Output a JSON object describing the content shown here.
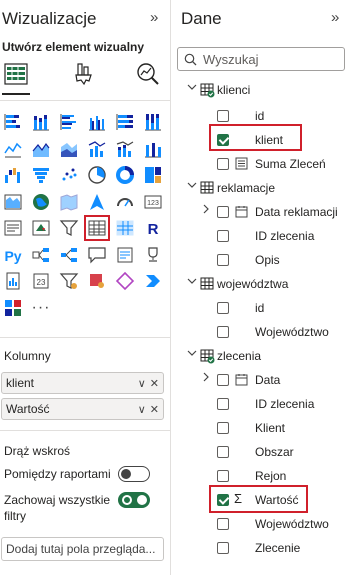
{
  "visualizations": {
    "title": "Wizualizacje",
    "collapse_icon": "chevron-double-right",
    "subtitle": "Utwórz element wizualny",
    "modes": [
      "build-visual-icon",
      "format-visual-icon",
      "analytics-icon"
    ],
    "gallery": [
      "stacked-bar-chart-icon",
      "stacked-column-chart-icon",
      "clustered-bar-chart-icon",
      "clustered-column-chart-icon",
      "100-stacked-bar-chart-icon",
      "100-stacked-column-chart-icon",
      "line-chart-icon",
      "area-chart-icon",
      "stacked-area-chart-icon",
      "line-and-column-chart-icon",
      "line-and-stacked-column-chart-icon",
      "ribbon-chart-icon",
      "waterfall-chart-icon",
      "funnel-chart-icon",
      "scatter-chart-icon",
      "pie-chart-icon",
      "donut-chart-icon",
      "treemap-icon",
      "map-icon",
      "filled-map-icon",
      "shape-map-icon",
      "azure-map-icon",
      "gauge-icon",
      "card-icon",
      "multi-row-card-icon",
      "kpi-icon",
      "slicer-icon",
      "table-icon",
      "matrix-icon",
      "r-visual-icon",
      "python-visual-icon",
      "key-influencers-icon",
      "decomposition-tree-icon",
      "qa-icon",
      "smart-narrative-icon",
      "trophy-icon",
      "paginated-report-icon",
      "power-apps-icon",
      "power-automate-icon",
      "diamond-visual-icon",
      "chevron-visual-icon",
      "arcgis-icon",
      "custom-visual-icon",
      "more-visuals-icon"
    ],
    "selected_gallery_item": "table-icon",
    "columns_label": "Kolumny",
    "wells": [
      {
        "text": "klient"
      },
      {
        "text": "Wartość"
      }
    ],
    "drill_label": "Drąż wskroś",
    "cross_report_label": "Pomiędzy raportami",
    "cross_report_state": "off",
    "keep_filters_label": "Zachowaj wszystkie filtry",
    "keep_filters_state": "on",
    "drill_placeholder": "Dodaj tutaj pola przegląda..."
  },
  "data_pane": {
    "title": "Dane",
    "search_placeholder": "Wyszukaj",
    "tables": [
      {
        "name": "klienci",
        "fields": [
          {
            "name": "id",
            "checked": false,
            "type": "plain",
            "expandable": false
          },
          {
            "name": "klient",
            "checked": true,
            "type": "plain",
            "expandable": false
          },
          {
            "name": "Suma Zleceń",
            "checked": false,
            "type": "measure",
            "expandable": false
          }
        ]
      },
      {
        "name": "reklamacje",
        "fields": [
          {
            "name": "Data reklamacji",
            "checked": false,
            "type": "date",
            "expandable": true
          },
          {
            "name": "ID zlecenia",
            "checked": false,
            "type": "plain",
            "expandable": false
          },
          {
            "name": "Opis",
            "checked": false,
            "type": "plain",
            "expandable": false
          }
        ]
      },
      {
        "name": "województwa",
        "fields": [
          {
            "name": "id",
            "checked": false,
            "type": "plain",
            "expandable": false
          },
          {
            "name": "Województwo",
            "checked": false,
            "type": "plain",
            "expandable": false
          }
        ]
      },
      {
        "name": "zlecenia",
        "fields": [
          {
            "name": "Data",
            "checked": false,
            "type": "date",
            "expandable": true
          },
          {
            "name": "ID zlecenia",
            "checked": false,
            "type": "plain",
            "expandable": false
          },
          {
            "name": "Klient",
            "checked": false,
            "type": "plain",
            "expandable": false
          },
          {
            "name": "Obszar",
            "checked": false,
            "type": "plain",
            "expandable": false
          },
          {
            "name": "Rejon",
            "checked": false,
            "type": "plain",
            "expandable": false
          },
          {
            "name": "Wartość",
            "checked": true,
            "type": "sum",
            "expandable": false
          },
          {
            "name": "Województwo",
            "checked": false,
            "type": "plain",
            "expandable": false
          },
          {
            "name": "Zlecenie",
            "checked": false,
            "type": "plain",
            "expandable": false
          }
        ]
      }
    ],
    "sum_symbol": "Σ"
  },
  "colors": {
    "accent_green": "#217346",
    "highlight_red": "#d0202b",
    "chart_blue": "#118dff",
    "chart_dark": "#12239e"
  }
}
